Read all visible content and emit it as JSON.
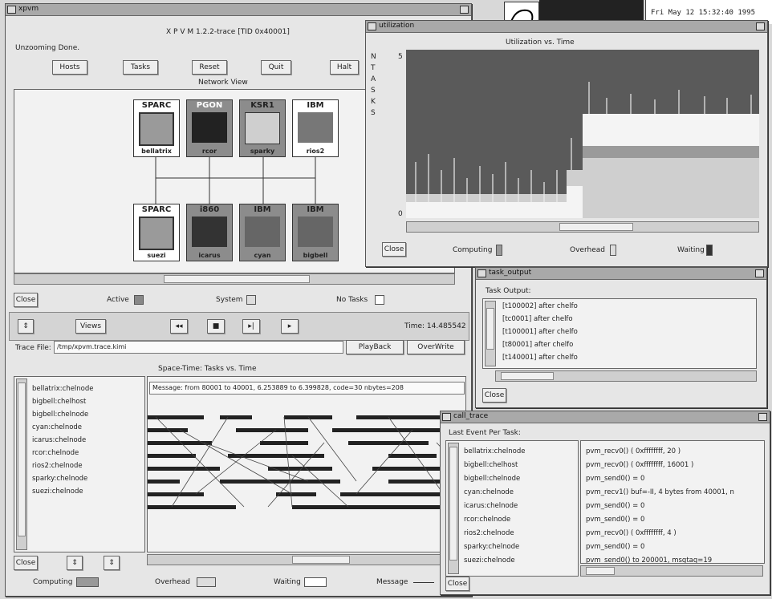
{
  "desktop": {
    "clock": "Fri May 12 15:32:40 1995"
  },
  "main": {
    "title": "xpvm",
    "app_title": "X P V M   1.2.2-trace  [TID 0x40001]",
    "status": "Unzooming Done.",
    "buttons": {
      "hosts": "Hosts",
      "tasks": "Tasks",
      "reset": "Reset",
      "quit": "Quit",
      "halt": "Halt"
    },
    "network_view_title": "Network View",
    "hosts": [
      {
        "hdr": "SPARC",
        "name": "bellatrix"
      },
      {
        "hdr": "PGON",
        "name": "rcor"
      },
      {
        "hdr": "KSR1",
        "name": "sparky"
      },
      {
        "hdr": "IBM",
        "name": "rios2"
      },
      {
        "hdr": "SPARC",
        "name": "suezi"
      },
      {
        "hdr": "i860",
        "name": "icarus"
      },
      {
        "hdr": "IBM",
        "name": "cyan"
      },
      {
        "hdr": "IBM",
        "name": "bigbell"
      }
    ],
    "close": "Close",
    "legend": {
      "active": "Active",
      "system": "System",
      "no_tasks": "No Tasks"
    },
    "views": "Views",
    "time": "Time: 14.485542",
    "trace_file_label": "Trace File:",
    "trace_file": "/tmp/xpvm.trace.kimi",
    "playback": "PlayBack",
    "overwrite": "OverWrite",
    "spacetime_title": "Space-Time: Tasks vs. Time",
    "message": "Message: from 80001 to 40001, 6.253889 to 6.399828, code=30 nbytes=208",
    "tasks": [
      "bellatrix:chelnode",
      "bigbell:chelhost",
      "bigbell:chelnode",
      "cyan:chelnode",
      "icarus:chelnode",
      "rcor:chelnode",
      "rios2:chelnode",
      "sparky:chelnode",
      "suezi:chelnode"
    ],
    "bottom_legend": {
      "computing": "Computing",
      "overhead": "Overhead",
      "waiting": "Waiting",
      "message": "Message"
    }
  },
  "util": {
    "title": "utilization",
    "chart_title": "Utilization vs. Time",
    "ylabel": "N T A S K S",
    "yticks": [
      "5",
      "0"
    ],
    "close": "Close",
    "legend": {
      "computing": "Computing",
      "overhead": "Overhead",
      "waiting": "Waiting"
    }
  },
  "taskout": {
    "title": "task_output",
    "label": "Task Output:",
    "lines": [
      "[t100002] after chelfo",
      "[tc0001] after chelfo",
      "[t100001] after chelfo",
      "[t80001] after chelfo",
      "[t140001] after chelfo"
    ],
    "close": "Close"
  },
  "calltrace": {
    "title": "call_trace",
    "label": "Last Event Per Task:",
    "tasks": [
      "bellatrix:chelnode",
      "bigbell:chelhost",
      "bigbell:chelnode",
      "cyan:chelnode",
      "icarus:chelnode",
      "rcor:chelnode",
      "rios2:chelnode",
      "sparky:chelnode",
      "suezi:chelnode"
    ],
    "events": [
      "pvm_recv0() ( 0xffffffff, 20 )",
      "pvm_recv0() ( 0xffffffff, 16001 )",
      "pvm_send0() = 0",
      "pvm_recv1() buf=-II, 4 bytes from 40001, n",
      "pvm_send0() = 0",
      "pvm_send0() = 0",
      "pvm_recv0() ( 0xffffffff, 4 )",
      "pvm_send0() = 0",
      "pvm_send0() to 200001, msgtag=19"
    ],
    "close": "Close"
  }
}
